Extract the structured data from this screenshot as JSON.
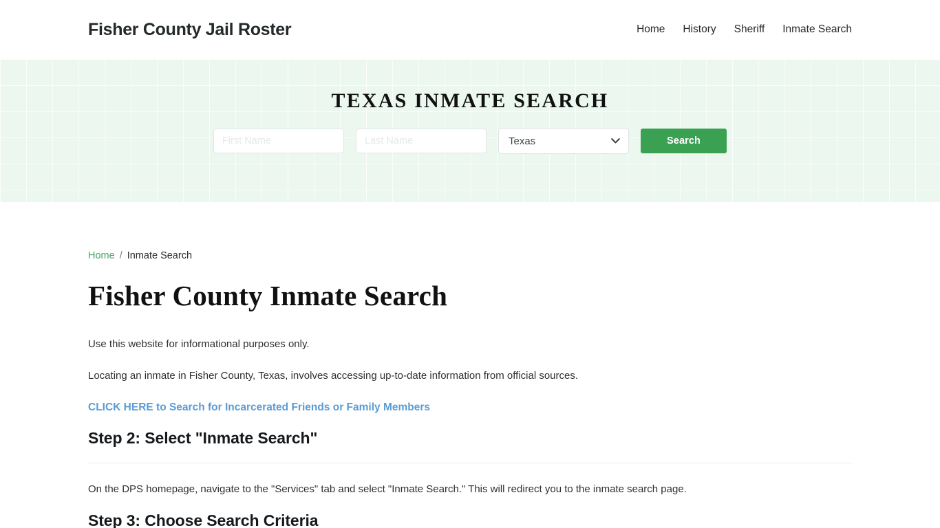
{
  "header": {
    "brand": "Fisher County Jail Roster",
    "nav": [
      {
        "label": "Home"
      },
      {
        "label": "History"
      },
      {
        "label": "Sheriff"
      },
      {
        "label": "Inmate Search"
      }
    ]
  },
  "hero": {
    "title": "TEXAS INMATE SEARCH",
    "first_name_placeholder": "First Name",
    "first_name_value": "",
    "last_name_placeholder": "Last Name",
    "last_name_value": "",
    "state_selected": "Texas",
    "state_options": [
      "Texas"
    ],
    "search_button": "Search",
    "background_color": "#ecf7f0",
    "button_color": "#3ba152"
  },
  "breadcrumb": {
    "home": "Home",
    "separator": "/",
    "current": "Inmate Search"
  },
  "main": {
    "page_title": "Fisher County Inmate Search",
    "paragraph_1": "Use this website for informational purposes only.",
    "paragraph_2": "Locating an inmate in Fisher County, Texas, involves accessing up-to-date information from official sources.",
    "cta_link": "CLICK HERE to Search for Incarcerated Friends or Family Members",
    "cta_link_color": "#5b9bd5",
    "step2_heading": "Step 2: Select \"Inmate Search\"",
    "step2_paragraph": "On the DPS homepage, navigate to the \"Services\" tab and select \"Inmate Search.\" This will redirect you to the inmate search page.",
    "step3_heading": "Step 3: Choose Search Criteria"
  }
}
